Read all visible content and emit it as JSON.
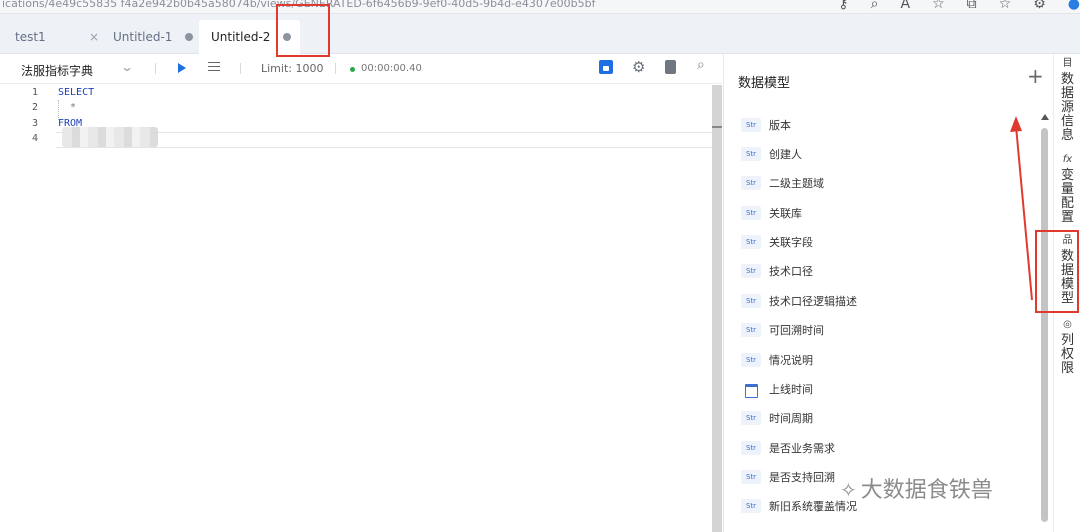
{
  "browser": {
    "url": "ications/4e49c55835 f4a2e942b0b45a58074b/views/GENERATED-6f6456b9-9ef0-40d5-9b4d-e4307e00b5bf",
    "icons": [
      "key-icon",
      "zoom-icon",
      "font-icon",
      "star-icon",
      "split-icon",
      "favorites-icon",
      "extensions-icon",
      "profile-icon"
    ],
    "icon_glyphs": [
      "⚷",
      "⌕",
      "A",
      "☆",
      "⧉",
      "☆",
      "⚙",
      "●"
    ]
  },
  "tabs": [
    {
      "label": "test1",
      "indicator": "×"
    },
    {
      "label": "Untitled-1",
      "indicator": "dot"
    },
    {
      "label": "Untitled-2",
      "indicator": "dot",
      "active": true
    }
  ],
  "toolbar": {
    "datasource": "法服指标字典",
    "limit_label": "Limit: 1000",
    "elapsed": "00:00:00.40",
    "status_color": "#2aa84a",
    "accent_color": "#1d6fe3"
  },
  "editor": {
    "lines": [
      {
        "num": "1",
        "text": "SELECT"
      },
      {
        "num": "2",
        "text": "  *"
      },
      {
        "num": "3",
        "text": "FROM"
      },
      {
        "num": "4",
        "text": ""
      }
    ]
  },
  "panel": {
    "title": "数据模型",
    "add_label": "+",
    "fields": [
      {
        "type": "Str",
        "name": "版本"
      },
      {
        "type": "Str",
        "name": "创建人"
      },
      {
        "type": "Str",
        "name": "二级主题域"
      },
      {
        "type": "Str",
        "name": "关联库"
      },
      {
        "type": "Str",
        "name": "关联字段"
      },
      {
        "type": "Str",
        "name": "技术口径"
      },
      {
        "type": "Str",
        "name": "技术口径逻辑描述"
      },
      {
        "type": "Str",
        "name": "可回溯时间"
      },
      {
        "type": "Str",
        "name": "情况说明"
      },
      {
        "type": "date",
        "name": "上线时间"
      },
      {
        "type": "Str",
        "name": "时间周期"
      },
      {
        "type": "Str",
        "name": "是否业务需求"
      },
      {
        "type": "Str",
        "name": "是否支持回溯"
      },
      {
        "type": "Str",
        "name": "新旧系统覆盖情况"
      }
    ]
  },
  "rail": [
    {
      "icon": "目",
      "label": "数据源信息",
      "icon_name": "catalog-icon"
    },
    {
      "icon": "fx",
      "label": "变量配置",
      "icon_name": "function-icon"
    },
    {
      "icon": "品",
      "label": "数据模型",
      "icon_name": "hierarchy-icon"
    },
    {
      "icon": "◎",
      "label": "列权限",
      "icon_name": "shield-icon"
    }
  ],
  "highlight_color": "#e03a2e",
  "watermark": "大数据食铁兽"
}
